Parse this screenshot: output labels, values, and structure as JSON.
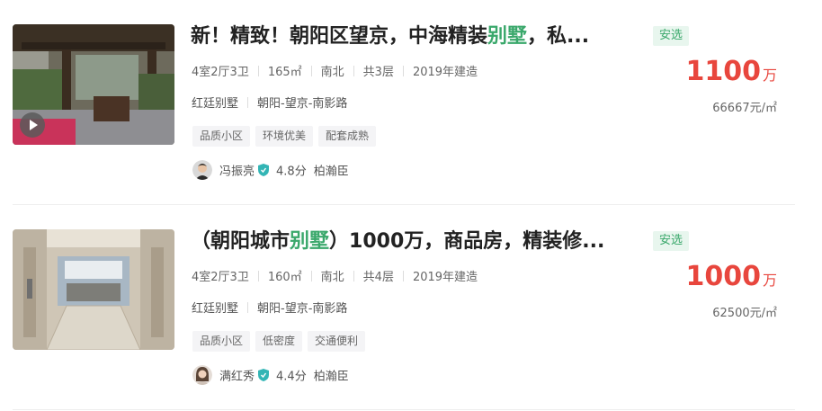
{
  "listings": [
    {
      "title_pre": "新！精致！朝阳区望京，中海精装",
      "title_hl": "别墅",
      "title_post": "，私...",
      "badge": "安选",
      "layout": "4室2厅3卫",
      "area": "165㎡",
      "orientation": "南北",
      "floors": "共3层",
      "year": "2019年建造",
      "community": "红廷别墅",
      "district": "朝阳-望京-南影路",
      "tags": [
        "品质小区",
        "环境优美",
        "配套成熟"
      ],
      "agent_name": "冯振亮",
      "agent_score": "4.8分",
      "agency": "柏瀚臣",
      "price": "1100",
      "price_unit": "万",
      "unit_price": "66667元/㎡",
      "has_video": true
    },
    {
      "title_pre": "（朝阳城市",
      "title_hl": "别墅",
      "title_post": "）1000万，商品房，精装修...",
      "badge": "安选",
      "layout": "4室2厅3卫",
      "area": "160㎡",
      "orientation": "南北",
      "floors": "共4层",
      "year": "2019年建造",
      "community": "红廷别墅",
      "district": "朝阳-望京-南影路",
      "tags": [
        "品质小区",
        "低密度",
        "交通便利"
      ],
      "agent_name": "满红秀",
      "agent_score": "4.4分",
      "agency": "柏瀚臣",
      "price": "1000",
      "price_unit": "万",
      "unit_price": "62500元/㎡",
      "has_video": false
    }
  ],
  "colors": {
    "accent_green": "#3aa86b",
    "price_red": "#e8463d",
    "verify_teal": "#33b5b5"
  }
}
